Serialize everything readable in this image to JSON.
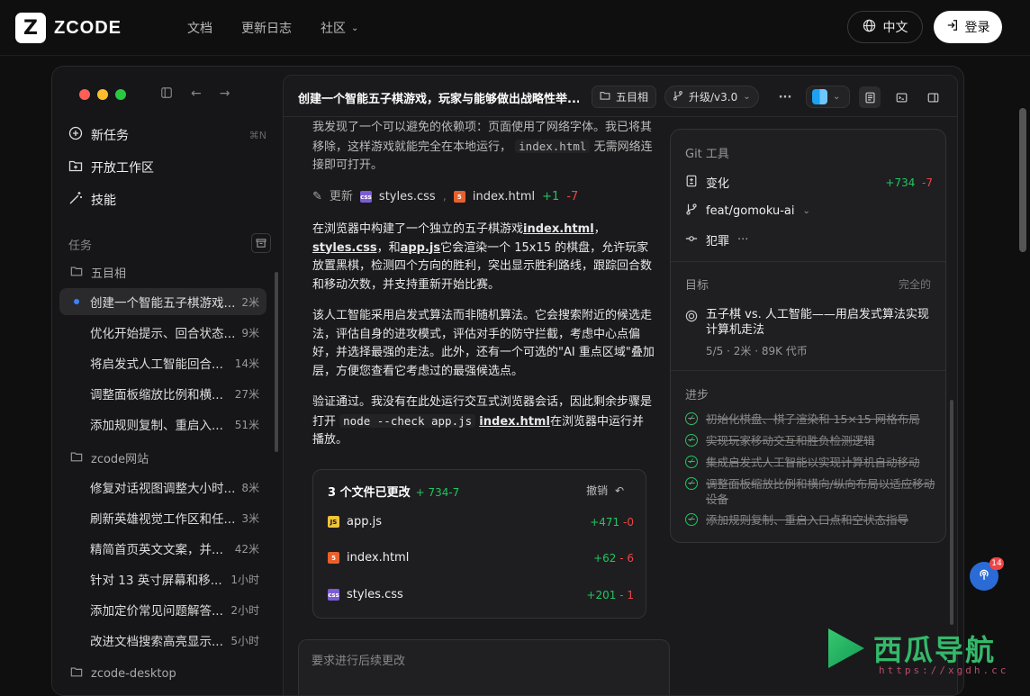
{
  "topnav": {
    "logo_mark": "Z",
    "logo_text": "ZCODE",
    "links": [
      "文档",
      "更新日志",
      "社区"
    ],
    "lang_label": "中文",
    "login_label": "登录"
  },
  "sidebar": {
    "new_task": "新任务",
    "new_task_shortcut": "⌘N",
    "open_workspace": "开放工作区",
    "skills": "技能",
    "tasks_label": "任务",
    "groups": [
      {
        "folder": "五目相",
        "tasks": [
          {
            "label": "创建一个智能五子棋游戏...",
            "time": "2米"
          },
          {
            "label": "优化开始提示、回合状态...",
            "time": "9米"
          },
          {
            "label": "将启发式人工智能回合...",
            "time": "14米"
          },
          {
            "label": "调整面板缩放比例和横...",
            "time": "27米"
          },
          {
            "label": "添加规则复制、重启入...",
            "time": "51米"
          }
        ]
      },
      {
        "folder": "zcode网站",
        "tasks": [
          {
            "label": "修复对话视图调整大小时...",
            "time": "8米"
          },
          {
            "label": "刷新英雄视觉工作区和任...",
            "time": "3米"
          },
          {
            "label": "精简首页英文文案，并...",
            "time": "42米"
          },
          {
            "label": "针对 13 英寸屏幕和移...",
            "time": "1小时"
          },
          {
            "label": "添加定价常见问题解答...",
            "time": "2小时"
          },
          {
            "label": "改进文档搜索高亮显示...",
            "time": "5小时"
          }
        ]
      },
      {
        "folder": "zcode-desktop",
        "tasks": []
      }
    ]
  },
  "header": {
    "title": "创建一个智能五子棋游戏，玩家与能够做出战略性举...",
    "project_chip": "五目相",
    "branch_chip": "升级/v3.0",
    "more": "···"
  },
  "chat": {
    "p0": "我发现了一个可以避免的依赖项：页面使用了网络字体。我已将其移除，这样游戏就能完全在本地运行，",
    "p0_code": "index.html",
    "p0_tail": "无需网络连接即可打开。",
    "update_label": "更新",
    "update_file1": "styles.css",
    "update_file2": "index.html",
    "update_add": "+1",
    "update_del": "-7",
    "p1_a": "在浏览器中构建了一个独立的五子棋游戏",
    "p1_link1": "index.html",
    "p1_b": "，",
    "p1_link2": "styles.css",
    "p1_c": "，和",
    "p1_link3": "app.js",
    "p1_d": "它会渲染一个 15x15 的棋盘，允许玩家放置黑棋，检测四个方向的胜利，突出显示胜利路线，跟踪回合数和移动次数，并支持重新开始比赛。",
    "p2": "该人工智能采用启发式算法而非随机算法。它会搜索附近的候选走法，评估自身的进攻模式，评估对手的防守拦截，考虑中心点偏好，并选择最强的走法。此外，还有一个可选的\"AI 重点区域\"叠加层，方便您查看它考虑过的最强候选点。",
    "p3_a": "验证通过。我没有在此处运行交互式浏览器会话，因此剩余步骤是打开",
    "p3_code": "node --check app.js",
    "p3_link": "index.html",
    "p3_b": "在浏览器中运行并播放。"
  },
  "files_card": {
    "title": "3 个文件已更改",
    "total": "+ 734-7",
    "undo": "撤销",
    "files": [
      {
        "name": "app.js",
        "icon": "js-file-icon",
        "add": "+471",
        "del": "-0"
      },
      {
        "name": "index.html",
        "icon": "html-file-icon",
        "add": "+62",
        "del": "- 6"
      },
      {
        "name": "styles.css",
        "icon": "css-file-icon",
        "add": "+201",
        "del": "- 1"
      }
    ]
  },
  "reply": {
    "placeholder": "要求进行后续更改"
  },
  "panel": {
    "git_title": "Git 工具",
    "changes": "变化",
    "changes_add": "+734",
    "changes_del": "-7",
    "branch": "feat/gomoku-ai",
    "commit": "犯罪",
    "commit_more": "···",
    "goal_label": "目标",
    "goal_status": "完全的",
    "goal_title": "五子棋 vs. 人工智能——用启发式算法实现计算机走法",
    "goal_meta": "5/5 · 2米 · 89K 代币",
    "progress_label": "进步",
    "progress": [
      "初始化棋盘、棋子渲染和 15×15 网格布局",
      "实现玩家移动交互和胜负检测逻辑",
      "集成启发式人工智能以实现计算机自动移动",
      "调整面板缩放比例和横向/纵向布局以适应移动设备",
      "添加规则复制、重启入口点和空状态指导"
    ]
  },
  "fab": {
    "badge": "14"
  },
  "watermark": {
    "text": "西瓜导航",
    "url": "https://xgdh.cc"
  },
  "colors": {
    "accent": "#3b82f6",
    "add": "#22c55e",
    "del": "#ef4444"
  }
}
